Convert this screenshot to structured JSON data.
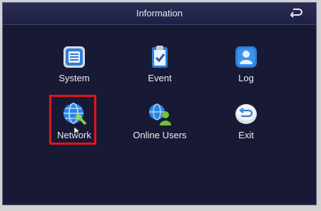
{
  "window": {
    "title": "Information"
  },
  "menu": [
    {
      "label": "System",
      "icon": "system-info-icon"
    },
    {
      "label": "Event",
      "icon": "event-clipboard-icon"
    },
    {
      "label": "Log",
      "icon": "log-user-icon"
    },
    {
      "label": "Network",
      "icon": "network-globe-icon"
    },
    {
      "label": "Online Users",
      "icon": "online-users-icon"
    },
    {
      "label": "Exit",
      "icon": "exit-icon"
    }
  ],
  "selected_item": "Network",
  "colors": {
    "background": "#181a35",
    "accent": "#2f8ee8",
    "selection": "#e3151b"
  }
}
